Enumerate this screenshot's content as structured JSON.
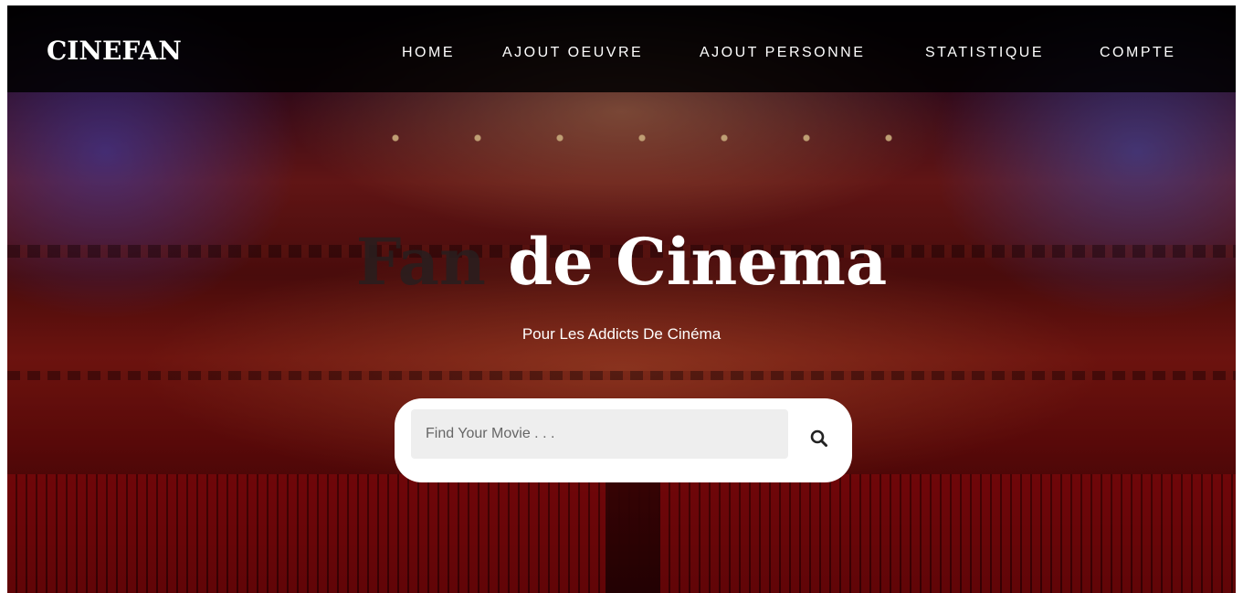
{
  "navbar": {
    "brand": "CINEFAN",
    "items": [
      {
        "label": "HOME"
      },
      {
        "label": "AJOUT OEUVRE"
      },
      {
        "label": "AJOUT PERSONNE"
      },
      {
        "label": "STATISTIQUE"
      },
      {
        "label": "COMPTE"
      }
    ]
  },
  "hero": {
    "title_dim": "Fan",
    "title_main": " de Cinema",
    "subtitle": "Pour Les Addicts De Cinéma"
  },
  "search": {
    "placeholder": "Find Your Movie . . .",
    "value": "",
    "icon": "search-icon"
  },
  "colors": {
    "navbar_bg": "#000000",
    "text": "#ffffff",
    "search_bg": "#ffffff",
    "input_bg": "#eeeeee"
  }
}
